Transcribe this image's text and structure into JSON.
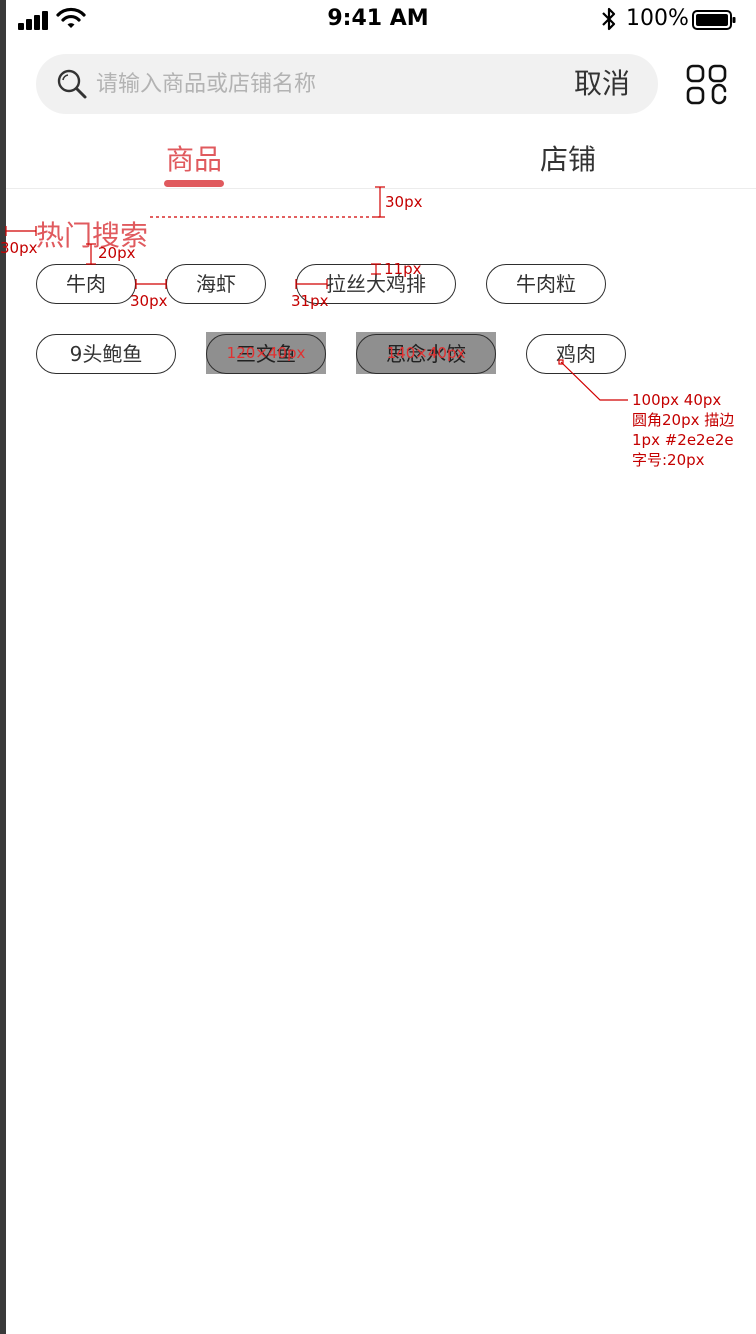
{
  "status_bar": {
    "time": "9:41 AM",
    "battery": "100%",
    "icons": [
      "signal-icon",
      "wifi-icon",
      "bluetooth-icon",
      "battery-icon"
    ]
  },
  "search": {
    "placeholder": "请输入商品或店铺名称",
    "value": "",
    "cancel_label": "取消",
    "icon": "search-icon"
  },
  "header_right_icon": "grid-icon",
  "tabs": [
    {
      "label": "商品",
      "active": true
    },
    {
      "label": "店铺",
      "active": false
    }
  ],
  "hot_search": {
    "title": "热门搜索",
    "tags_row1": [
      "牛肉",
      "海虾",
      "拉丝大鸡排",
      "牛肉粒"
    ],
    "tags_row2": [
      "9头鲍鱼",
      "三文鱼",
      "思念水饺",
      "鸡肉"
    ]
  },
  "annotations": {
    "top_gap": "30px",
    "left_margin": "30px",
    "title_gap": "20px",
    "tag_gap": "30px",
    "tag_gap_b": "31px",
    "text_gap": "11px",
    "size_120": "120×40px",
    "size_140": "140×40px",
    "spec_line1": "100px 40px",
    "spec_line2": "圆角20px 描边",
    "spec_line3": "1px #2e2e2e",
    "spec_line4": "字号:20px"
  },
  "colors": {
    "accent": "#e05a5e",
    "tag_border": "#2e2e2e",
    "annotation": "#c40000",
    "search_bg": "#f1f1f1"
  }
}
